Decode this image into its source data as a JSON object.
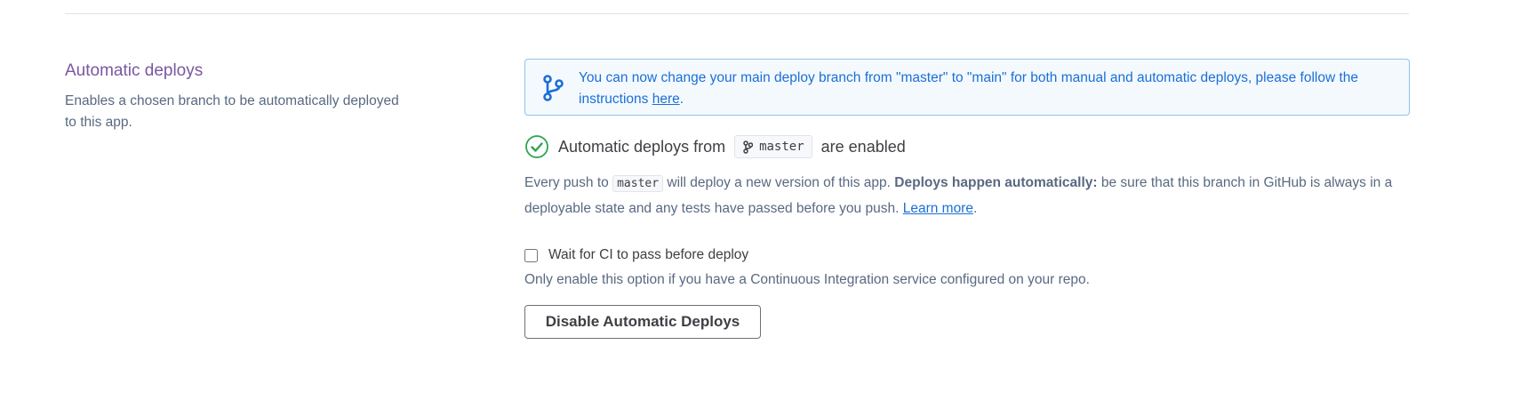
{
  "section": {
    "title": "Automatic deploys",
    "description": "Enables a chosen branch to be automatically deployed to this app."
  },
  "notice": {
    "icon": "git-branch-icon",
    "text_before_link": "You can now change your main deploy branch from \"master\" to \"main\" for both manual and automatic deploys, please follow the instructions ",
    "link_text": "here",
    "text_after_link": "."
  },
  "status": {
    "icon": "check-circle-icon",
    "prefix": "Automatic deploys from",
    "branch": "master",
    "suffix": "are enabled"
  },
  "push_info": {
    "part1": "Every push to",
    "branch": "master",
    "part2": "will deploy a new version of this app.",
    "bold": "Deploys happen automatically:",
    "part3": "be sure that this branch in GitHub is always in a deployable state and any tests have passed before you push.",
    "link_text": "Learn more",
    "end": "."
  },
  "ci": {
    "checked": false,
    "label": "Wait for CI to pass before deploy",
    "help": "Only enable this option if you have a Continuous Integration service configured on your repo."
  },
  "actions": {
    "disable_label": "Disable Automatic Deploys"
  },
  "colors": {
    "section_title": "#79589f",
    "notice_text": "#1a6fd6",
    "notice_border": "#8fc3ee",
    "notice_bg": "#f4f9fe",
    "success": "#2da44e"
  }
}
